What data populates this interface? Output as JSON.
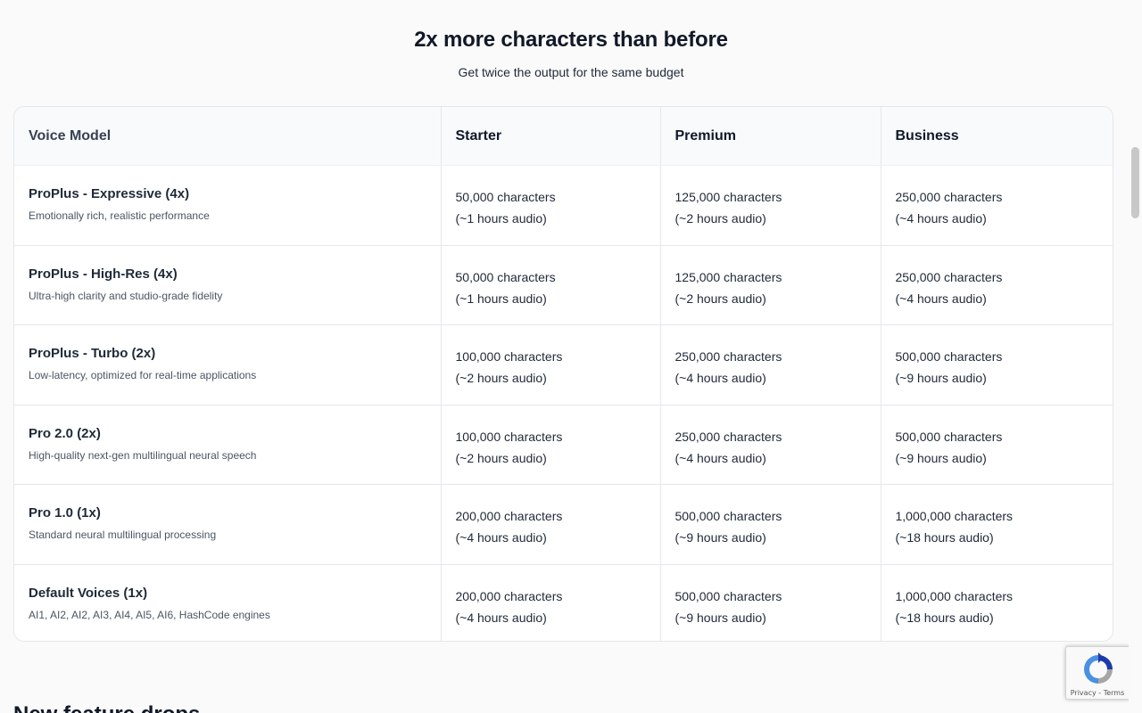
{
  "hero": {
    "title": "2x more characters than before",
    "subtitle": "Get twice the output for the same budget"
  },
  "table": {
    "headers": [
      "Voice Model",
      "Starter",
      "Premium",
      "Business"
    ],
    "rows": [
      {
        "name": "ProPlus - Expressive (4x)",
        "desc": "Emotionally rich, realistic performance",
        "starter": [
          "50,000 characters",
          "(~1 hours audio)"
        ],
        "premium": [
          "125,000 characters",
          "(~2 hours audio)"
        ],
        "business": [
          "250,000 characters",
          "(~4 hours audio)"
        ]
      },
      {
        "name": "ProPlus - High-Res (4x)",
        "desc": "Ultra-high clarity and studio-grade fidelity",
        "starter": [
          "50,000 characters",
          "(~1 hours audio)"
        ],
        "premium": [
          "125,000 characters",
          "(~2 hours audio)"
        ],
        "business": [
          "250,000 characters",
          "(~4 hours audio)"
        ]
      },
      {
        "name": "ProPlus - Turbo (2x)",
        "desc": "Low-latency, optimized for real-time applications",
        "starter": [
          "100,000 characters",
          "(~2 hours audio)"
        ],
        "premium": [
          "250,000 characters",
          "(~4 hours audio)"
        ],
        "business": [
          "500,000 characters",
          "(~9 hours audio)"
        ]
      },
      {
        "name": "Pro 2.0 (2x)",
        "desc": "High-quality next-gen multilingual neural speech",
        "starter": [
          "100,000 characters",
          "(~2 hours audio)"
        ],
        "premium": [
          "250,000 characters",
          "(~4 hours audio)"
        ],
        "business": [
          "500,000 characters",
          "(~9 hours audio)"
        ]
      },
      {
        "name": "Pro 1.0 (1x)",
        "desc": "Standard neural multilingual processing",
        "starter": [
          "200,000 characters",
          "(~4 hours audio)"
        ],
        "premium": [
          "500,000 characters",
          "(~9 hours audio)"
        ],
        "business": [
          "1,000,000 characters",
          "(~18 hours audio)"
        ]
      },
      {
        "name": "Default Voices (1x)",
        "desc": "AI1, AI2, AI2, AI3, AI4, AI5, AI6, HashCode engines",
        "starter": [
          "200,000 characters",
          "(~4 hours audio)"
        ],
        "premium": [
          "500,000 characters",
          "(~9 hours audio)"
        ],
        "business": [
          "1,000,000 characters",
          "(~18 hours audio)"
        ]
      }
    ]
  },
  "next_section": {
    "title": "New feature drops"
  },
  "recaptcha": {
    "privacy": "Privacy",
    "separator": " - ",
    "terms": "Terms",
    "icon": "recaptcha-logo-icon"
  },
  "colors": {
    "header_bg": "#f8fafc",
    "border": "#e5e7eb",
    "text": "#1f2937",
    "muted": "#4b5563"
  }
}
